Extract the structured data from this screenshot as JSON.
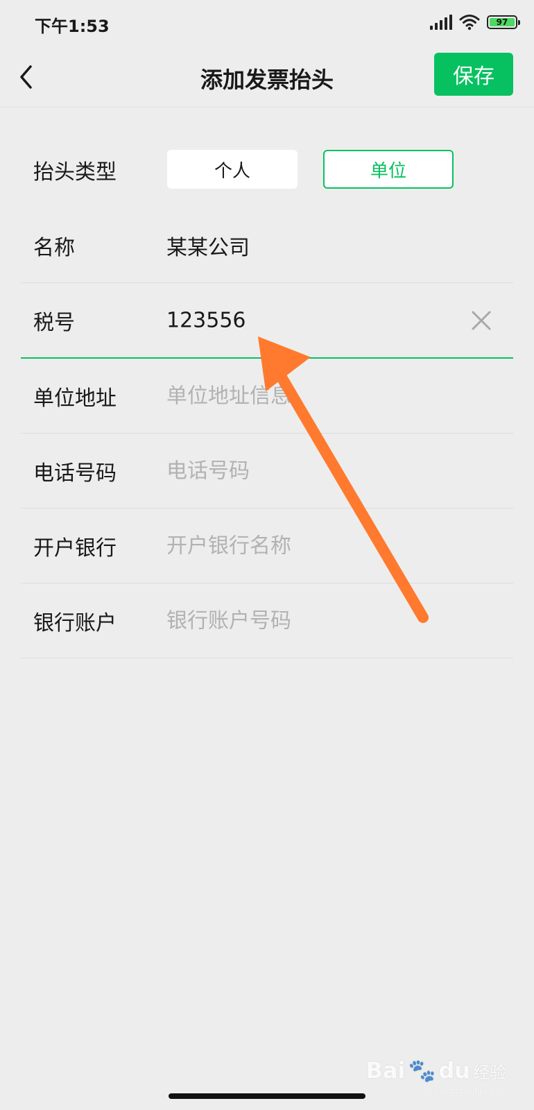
{
  "status_bar": {
    "time": "下午1:53",
    "battery_level": "97",
    "icons": [
      "signal-icon",
      "wifi-icon",
      "battery-icon"
    ]
  },
  "nav": {
    "title": "添加发票抬头",
    "back_icon": "chevron-left-icon",
    "save_label": "保存"
  },
  "form": {
    "type_row": {
      "label": "抬头类型",
      "options": [
        "个人",
        "单位"
      ],
      "selected": "单位"
    },
    "fields": [
      {
        "label": "名称",
        "value": "某某公司",
        "placeholder": ""
      },
      {
        "label": "税号",
        "value": "123556",
        "placeholder": ""
      },
      {
        "label": "单位地址",
        "value": "",
        "placeholder": "单位地址信息"
      },
      {
        "label": "电话号码",
        "value": "",
        "placeholder": "电话号码"
      },
      {
        "label": "开户银行",
        "value": "",
        "placeholder": "开户银行名称"
      },
      {
        "label": "银行账户",
        "value": "",
        "placeholder": "银行账户号码"
      }
    ],
    "clear_icon": "close-icon"
  },
  "watermark": {
    "brand": "Bai",
    "brand_du": "du",
    "sub": "经验",
    "url": "jingyan.baidu.com"
  },
  "colors": {
    "accent": "#07c160",
    "annotation_arrow": "#ff7a2e",
    "background": "#ededed"
  }
}
